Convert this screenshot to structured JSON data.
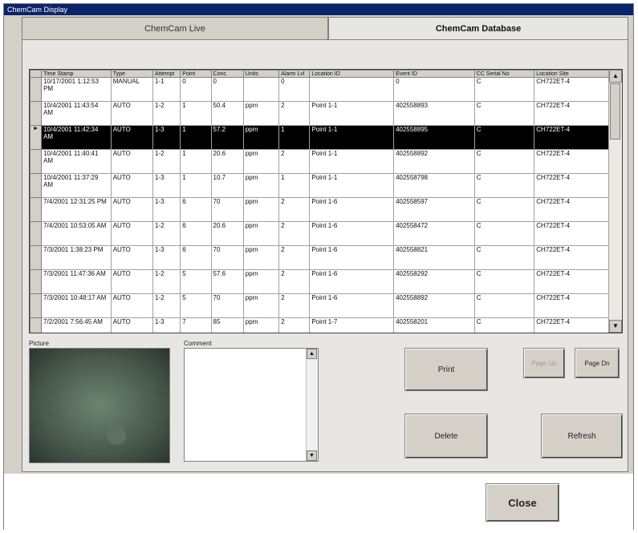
{
  "window": {
    "title": "ChemCam Display"
  },
  "tabs": [
    {
      "label": "ChemCam Live"
    },
    {
      "label": "ChemCam Database"
    }
  ],
  "grid": {
    "columns": [
      "Time Stamp",
      "Type",
      "Attempt",
      "Point",
      "Conc",
      "Units",
      "Alarm Lvl",
      "Location ID",
      "Event ID",
      "CC Serial No",
      "Location Site"
    ],
    "rows": [
      [
        "10/17/2001 1:12:53 PM",
        "MANUAL",
        "1-1",
        "0",
        "0",
        "",
        "0",
        "",
        "0",
        "C",
        "CH722ET-4"
      ],
      [
        "10/4/2001 11:43:54 AM",
        "AUTO",
        "1-2",
        "1",
        "50.4",
        "ppm",
        "2",
        "Point 1-1",
        "402558893",
        "C",
        "CH722ET-4"
      ],
      [
        "10/4/2001 11:42:34 AM",
        "AUTO",
        "1-3",
        "1",
        "57.2",
        "ppm",
        "1",
        "Point 1-1",
        "402558895",
        "C",
        "CH722ET-4"
      ],
      [
        "10/4/2001 11:40:41 AM",
        "AUTO",
        "1-2",
        "1",
        "20.6",
        "ppm",
        "2",
        "Point 1-1",
        "402558892",
        "C",
        "CH722ET-4"
      ],
      [
        "10/4/2001 11:37:29 AM",
        "AUTO",
        "1-3",
        "1",
        "10.7",
        "ppm",
        "1",
        "Point 1-1",
        "402558798",
        "C",
        "CH722ET-4"
      ],
      [
        "7/4/2001 12:31:25 PM",
        "AUTO",
        "1-3",
        "6",
        "70",
        "ppm",
        "2",
        "Point 1-6",
        "402558597",
        "C",
        "CH722ET-4"
      ],
      [
        "7/4/2001 10:53:05 AM",
        "AUTO",
        "1-2",
        "6",
        "20.6",
        "ppm",
        "2",
        "Point 1-6",
        "402558472",
        "C",
        "CH722ET-4"
      ],
      [
        "7/3/2001 1:38:23 PM",
        "AUTO",
        "1-3",
        "6",
        "70",
        "ppm",
        "2",
        "Point 1-6",
        "402558821",
        "C",
        "CH722ET-4"
      ],
      [
        "7/3/2001 11:47:36 AM",
        "AUTO",
        "1-2",
        "5",
        "57.6",
        "ppm",
        "2",
        "Point 1-6",
        "402558292",
        "C",
        "CH722ET-4"
      ],
      [
        "7/3/2001 10:48:17 AM",
        "AUTO",
        "1-2",
        "5",
        "70",
        "ppm",
        "2",
        "Point 1-6",
        "402558892",
        "C",
        "CH722ET-4"
      ],
      [
        "7/2/2001 7:56:45 AM",
        "AUTO",
        "1-3",
        "7",
        "85",
        "ppm",
        "2",
        "Point 1-7",
        "402558201",
        "C",
        "CH722ET-4"
      ]
    ],
    "selected_row": 2,
    "row_indicator": "►"
  },
  "labels": {
    "picture": "Picture",
    "comment": "Comment"
  },
  "buttons": {
    "print": "Print",
    "delete": "Delete",
    "refresh": "Refresh",
    "page_up": "Page Up",
    "page_down": "Page Dn",
    "close": "Close"
  },
  "icons": {
    "scroll_up": "▲",
    "scroll_down": "▼"
  }
}
